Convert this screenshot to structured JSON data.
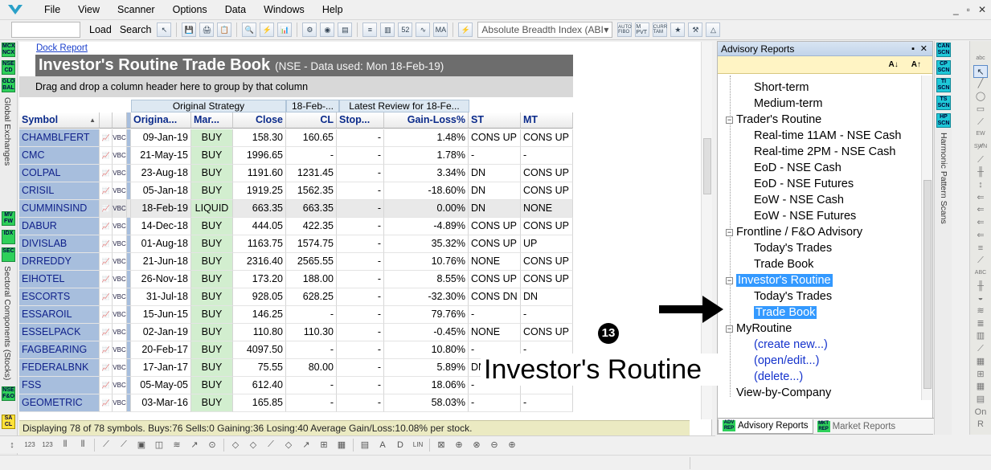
{
  "menu": [
    "File",
    "View",
    "Scanner",
    "Options",
    "Data",
    "Windows",
    "Help"
  ],
  "window_controls": [
    "_",
    "▫",
    "✕"
  ],
  "toolbar": {
    "load_label": "Load",
    "search_label": "Search",
    "indicator_select": "Absolute Breadth Index (ABI",
    "icons_left": [
      "💾",
      "🖨",
      "📋",
      "🔍",
      "⚡",
      "📊"
    ],
    "icons_right": [
      "AUTO FIBO",
      "M PVT",
      "CURR TAM",
      "★",
      "⚒",
      "△"
    ]
  },
  "left_strip": {
    "badges": [
      "MCX NCX",
      "NSE CD",
      "GLO BAL",
      "MV FW",
      "IDX",
      "SEC",
      "NSE F&O",
      "SA CL"
    ],
    "labels": [
      "Global Exchanges",
      "Sectoral Components (Stocks)"
    ]
  },
  "report": {
    "dock_link": "Dock Report",
    "title": "Investor's Routine Trade Book",
    "subtitle": "(NSE - Data used: Mon 18-Feb-19)",
    "group_hint": "Drag and drop a column header here to group by that column",
    "bands": [
      "Original Strategy",
      "18-Feb-...",
      "Latest Review  for  18-Fe..."
    ],
    "columns": [
      "Symbol",
      "Origina...",
      "Mar...",
      "Close",
      "CL",
      "Stop...",
      "Gain-Loss%",
      "ST",
      "MT"
    ],
    "sort_icon": "▲",
    "rows": [
      {
        "sym": "CHAMBLFERT",
        "date": "09-Jan-19",
        "mar": "BUY",
        "close": "158.30",
        "cl": "160.65",
        "stop": "-",
        "gl": "1.48%",
        "st": "CONS UP",
        "mt": "CONS UP"
      },
      {
        "sym": "CMC",
        "date": "21-May-15",
        "mar": "BUY",
        "close": "1996.65",
        "cl": "-",
        "stop": "-",
        "gl": "1.78%",
        "st": "-",
        "mt": "-"
      },
      {
        "sym": "COLPAL",
        "date": "23-Aug-18",
        "mar": "BUY",
        "close": "1191.60",
        "cl": "1231.45",
        "stop": "-",
        "gl": "3.34%",
        "st": "DN",
        "mt": "CONS UP"
      },
      {
        "sym": "CRISIL",
        "date": "05-Jan-18",
        "mar": "BUY",
        "close": "1919.25",
        "cl": "1562.35",
        "stop": "-",
        "gl": "-18.60%",
        "st": "DN",
        "mt": "CONS UP"
      },
      {
        "sym": "CUMMINSIND",
        "date": "18-Feb-19",
        "mar": "LIQUID",
        "close": "663.35",
        "cl": "663.35",
        "stop": "-",
        "gl": "0.00%",
        "st": "DN",
        "mt": "NONE"
      },
      {
        "sym": "DABUR",
        "date": "14-Dec-18",
        "mar": "BUY",
        "close": "444.05",
        "cl": "422.35",
        "stop": "-",
        "gl": "-4.89%",
        "st": "CONS UP",
        "mt": "CONS UP"
      },
      {
        "sym": "DIVISLAB",
        "date": "01-Aug-18",
        "mar": "BUY",
        "close": "1163.75",
        "cl": "1574.75",
        "stop": "-",
        "gl": "35.32%",
        "st": "CONS UP",
        "mt": "UP"
      },
      {
        "sym": "DRREDDY",
        "date": "21-Jun-18",
        "mar": "BUY",
        "close": "2316.40",
        "cl": "2565.55",
        "stop": "-",
        "gl": "10.76%",
        "st": "NONE",
        "mt": "CONS UP"
      },
      {
        "sym": "EIHOTEL",
        "date": "26-Nov-18",
        "mar": "BUY",
        "close": "173.20",
        "cl": "188.00",
        "stop": "-",
        "gl": "8.55%",
        "st": "CONS UP",
        "mt": "CONS UP"
      },
      {
        "sym": "ESCORTS",
        "date": "31-Jul-18",
        "mar": "BUY",
        "close": "928.05",
        "cl": "628.25",
        "stop": "-",
        "gl": "-32.30%",
        "st": "CONS DN",
        "mt": "DN"
      },
      {
        "sym": "ESSAROIL",
        "date": "15-Jun-15",
        "mar": "BUY",
        "close": "146.25",
        "cl": "-",
        "stop": "-",
        "gl": "79.76%",
        "st": "-",
        "mt": "-"
      },
      {
        "sym": "ESSELPACK",
        "date": "02-Jan-19",
        "mar": "BUY",
        "close": "110.80",
        "cl": "110.30",
        "stop": "-",
        "gl": "-0.45%",
        "st": "NONE",
        "mt": "CONS UP"
      },
      {
        "sym": "FAGBEARING",
        "date": "20-Feb-17",
        "mar": "BUY",
        "close": "4097.50",
        "cl": "-",
        "stop": "-",
        "gl": "10.80%",
        "st": "-",
        "mt": "-"
      },
      {
        "sym": "FEDERALBNK",
        "date": "17-Jan-17",
        "mar": "BUY",
        "close": "75.55",
        "cl": "80.00",
        "stop": "-",
        "gl": "5.89%",
        "st": "DN",
        "mt": ""
      },
      {
        "sym": "FSS",
        "date": "05-May-05",
        "mar": "BUY",
        "close": "612.40",
        "cl": "-",
        "stop": "-",
        "gl": "18.06%",
        "st": "-",
        "mt": "-"
      },
      {
        "sym": "GEOMETRIC",
        "date": "03-Mar-16",
        "mar": "BUY",
        "close": "165.85",
        "cl": "-",
        "stop": "-",
        "gl": "58.03%",
        "st": "-",
        "mt": "-"
      }
    ],
    "row_icon1": "📈",
    "row_icon2": "VBC",
    "status": "Displaying 78 of 78 symbols. Buys:76 Sells:0 Gaining:36 Losing:40 Average Gain/Loss:10.08% per stock."
  },
  "bottom_toolbar": [
    "↕",
    "123",
    "123",
    "⫴",
    "⫴",
    "⟋",
    "⟋",
    "▣",
    "◫",
    "≋",
    "↗",
    "⊙",
    "◇",
    "◇",
    "⟋",
    "◇",
    "↗",
    "⊞",
    "▦",
    "▤",
    "A",
    "D",
    "LIN",
    "⊠",
    "⊕",
    "⊗",
    "⊖",
    "⊕"
  ],
  "advisory": {
    "title": "Advisory Reports",
    "pin": "📌",
    "close": "✕",
    "sort_az": "A↓",
    "sort_za": "A↑",
    "tree": [
      {
        "label": "Short-term",
        "level": 2
      },
      {
        "label": "Medium-term",
        "level": 2
      },
      {
        "label": "Trader's Routine",
        "level": 1,
        "exp": "−"
      },
      {
        "label": "Real-time 11AM - NSE Cash",
        "level": 2
      },
      {
        "label": "Real-time 2PM - NSE Cash",
        "level": 2
      },
      {
        "label": "EoD - NSE Cash",
        "level": 2
      },
      {
        "label": "EoD - NSE Futures",
        "level": 2
      },
      {
        "label": "EoW - NSE Cash",
        "level": 2
      },
      {
        "label": "EoW - NSE Futures",
        "level": 2
      },
      {
        "label": "Frontline / F&O Advisory",
        "level": 1,
        "exp": "−"
      },
      {
        "label": "Today's Trades",
        "level": 2
      },
      {
        "label": "Trade Book",
        "level": 2
      },
      {
        "label": "Investor's Routine",
        "level": 1,
        "exp": "−",
        "sel": true
      },
      {
        "label": "Today's Trades",
        "level": 2
      },
      {
        "label": "Trade Book",
        "level": 2,
        "sel": true
      },
      {
        "label": "MyRoutine",
        "level": 1,
        "exp": "−"
      },
      {
        "label": "(create new...)",
        "level": 2,
        "link": true
      },
      {
        "label": "(open/edit...)",
        "level": 2,
        "link": true
      },
      {
        "label": "(delete...)",
        "level": 2,
        "link": true
      },
      {
        "label": "View-by-Company",
        "level": 1
      }
    ],
    "tabs": [
      {
        "icon": "ADV REP",
        "label": "Advisory Reports"
      },
      {
        "icon": "MKT REP",
        "label": "Market Reports"
      }
    ]
  },
  "right_strip": {
    "badges": [
      "CAN SCN",
      "CP SCN",
      "TI SCN",
      "TS SCN",
      "HP SCN"
    ],
    "label": "Harmonic Pattern Scans",
    "tools": [
      "abc",
      "↖",
      "╱",
      "◯",
      "▭",
      "⟋",
      "EW SWN",
      "⟋",
      "⟋",
      "╫",
      "↕",
      "⇐",
      "⇐",
      "⇐",
      "⇐",
      "≡",
      "⟋",
      "ABC",
      "╫",
      "◒",
      "≋",
      "≣",
      "▥",
      "⟋",
      "▦",
      "⊞",
      "▦",
      "▤",
      "On",
      "R"
    ]
  },
  "annotation": {
    "number": "13",
    "text": "Investor's Routine"
  }
}
